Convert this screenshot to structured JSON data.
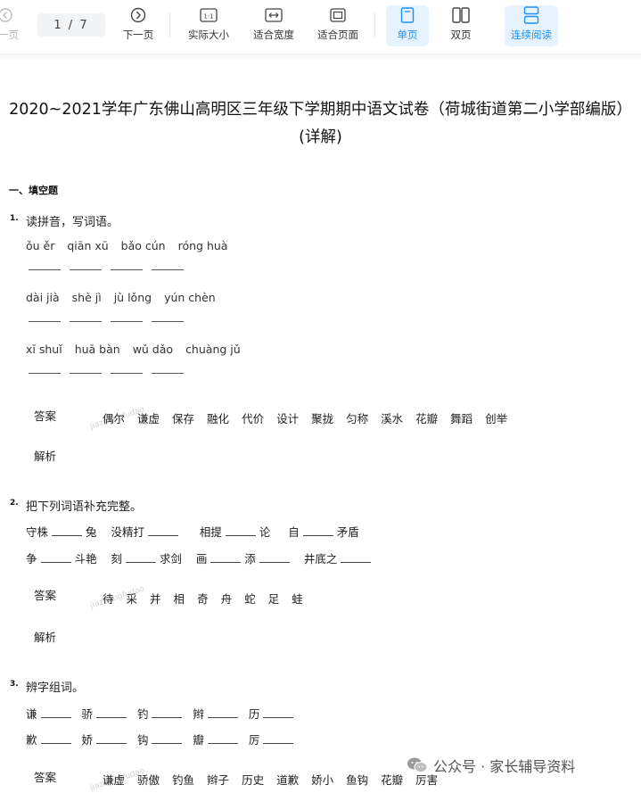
{
  "toolbar": {
    "prev_page_label": "一页",
    "page_indicator": "1  / 7",
    "next_page_label": "下一页",
    "actual_size_label": "实际大小",
    "fit_width_label": "适合宽度",
    "fit_page_label": "适合页面",
    "single_page_label": "单页",
    "double_page_label": "双页",
    "continuous_label": "连续阅读",
    "accent_color": "#1d8ff2"
  },
  "document": {
    "title_line1": "2020~2021学年广东佛山高明区三年级下学期期中语文试卷（荷城街道第二小学部编版）",
    "title_line2": "(详解)",
    "section_heading": "一、填空题",
    "answer_label": "答案",
    "analysis_label": "解析",
    "watermark_text": "jiazhangfudao"
  },
  "q1": {
    "number": "1.",
    "prompt": "读拼音，写词语。",
    "pinyin_rows": [
      [
        "ǒu ěr",
        "qiān xū",
        "bǎo cún",
        "róng huà"
      ],
      [
        "dài jià",
        "shè jì",
        "jù lǒng",
        "yún chèn"
      ],
      [
        "xī shuǐ",
        "huā bàn",
        "wǔ dǎo",
        "chuàng jǔ"
      ]
    ],
    "answers": [
      "偶尔",
      "谦虚",
      "保存",
      "融化",
      "代价",
      "设计",
      "聚拢",
      "匀称",
      "溪水",
      "花瓣",
      "舞蹈",
      "创举"
    ]
  },
  "q2": {
    "number": "2.",
    "prompt": "把下列词语补充完整。",
    "row1": [
      {
        "pre": "守株",
        "post": "兔"
      },
      {
        "pre": "没精打",
        "post": ""
      },
      {
        "pre": "相提",
        "post": "论"
      },
      {
        "pre": "自",
        "post": "矛盾"
      }
    ],
    "row2": [
      {
        "pre": "争",
        "post": "斗艳"
      },
      {
        "pre": "刻",
        "post": "求剑"
      },
      {
        "pre": "画",
        "post": "添"
      },
      {
        "pre": "",
        "post": "井底之"
      }
    ],
    "answers": [
      "待",
      "采",
      "并",
      "相",
      "奇",
      "舟",
      "蛇",
      "足",
      "蛙"
    ]
  },
  "q3": {
    "number": "3.",
    "prompt": "辨字组词。",
    "row1": [
      "谦",
      "骄",
      "钓",
      "辫",
      "历"
    ],
    "row2": [
      "歉",
      "娇",
      "钩",
      "瓣",
      "厉"
    ],
    "answers": [
      "谦虚",
      "骄傲",
      "钓鱼",
      "辫子",
      "历史",
      "道歉",
      "娇小",
      "鱼钩",
      "花瓣",
      "厉害"
    ]
  },
  "footer": {
    "wechat_label": "公众号 · 家长辅导资料"
  }
}
